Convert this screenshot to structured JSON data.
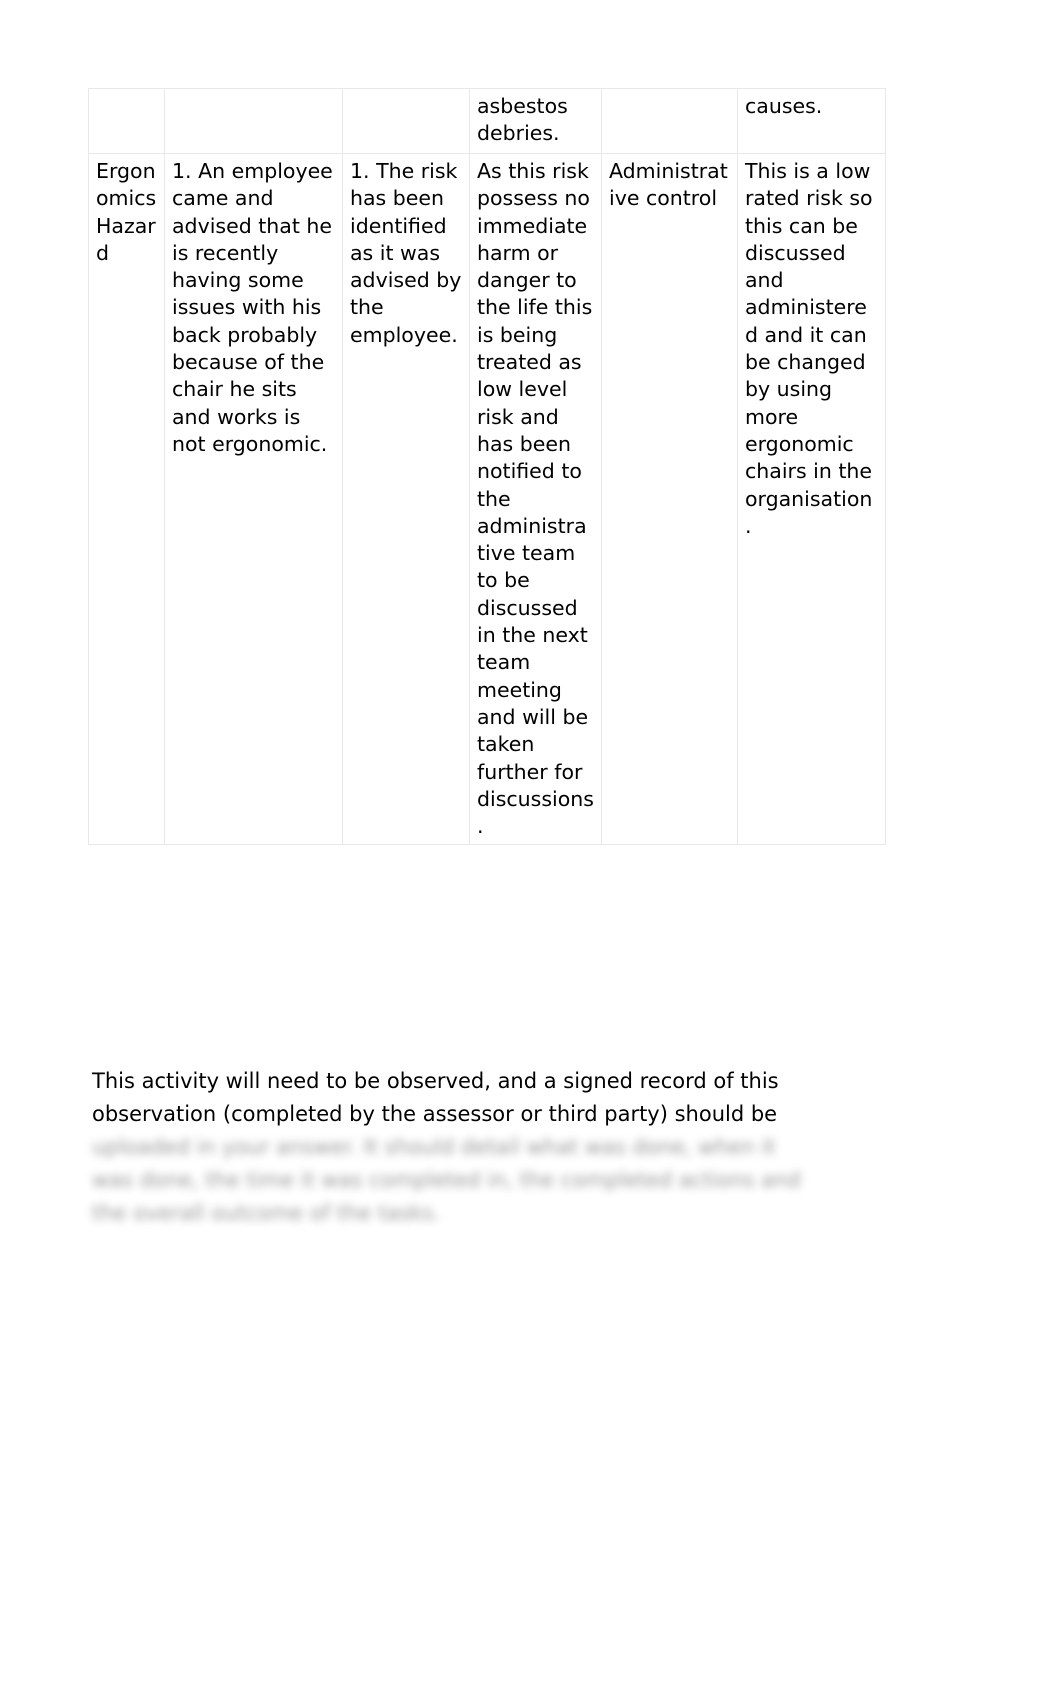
{
  "document": {
    "type": "risk-assessment-table-continuation"
  },
  "table": {
    "name": "risk-assessment-table",
    "columns": [
      "hazard-type",
      "hazard-description",
      "risk-identification",
      "risk-evaluation",
      "control-measure",
      "recommendation"
    ],
    "rows": [
      {
        "name": "continuation-row",
        "cells": [
          "",
          "",
          "",
          "asbestos debries.",
          "",
          "causes."
        ]
      },
      {
        "name": "ergonomics-hazard-row",
        "cells": [
          "Ergonomics Hazard",
          "1. An employee came and advised that he is recently having some issues with his back probably because of the chair he sits and works is not ergonomic.",
          "1. The risk has been identified as it was advised by the employee.",
          "As this risk possess no immediate harm or danger to the life this is being treated as low level risk and has been notified to the administrative team to be discussed in the next team meeting and will be taken further for discussions.",
          "Administrative control",
          "This is a low rated risk so this can be discussed and administered and it can be changed by using more ergonomic chairs in the organisation."
        ]
      }
    ]
  },
  "paragraph": {
    "name": "observation-instruction-paragraph",
    "lines": [
      {
        "text": "This activity will need to be observed, and a signed record of this",
        "blurred": false
      },
      {
        "text": "observation (completed by the assessor or third party) should be",
        "blurred": false
      },
      {
        "text": "uploaded in your answer. It should detail what was done, when it",
        "blurred": true
      },
      {
        "text": "was done, the time it was completed in, the completed actions and",
        "blurred": true
      },
      {
        "text": "the overall outcome of the tasks.",
        "blurred": true
      }
    ]
  },
  "colors": {
    "page_background": "#ffffff",
    "text": "#000000",
    "table_border": "#e8e8e8",
    "blurred_text": "#6f6f6f"
  }
}
